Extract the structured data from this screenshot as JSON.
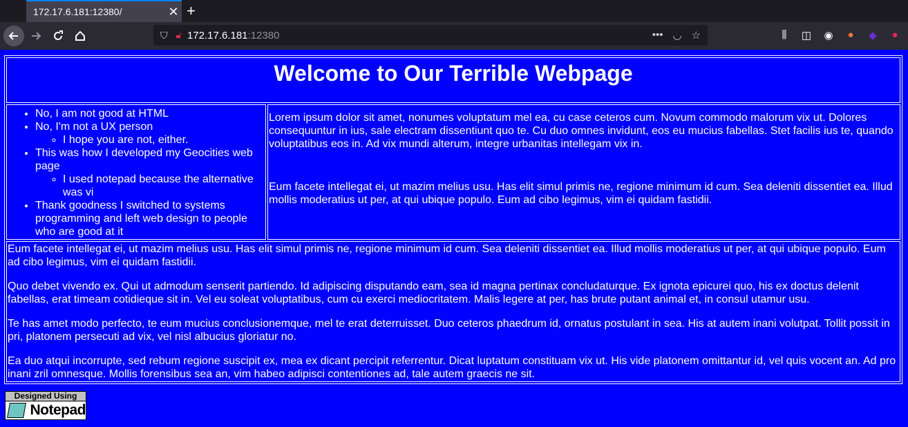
{
  "browser": {
    "tab_title": "172.17.6.181:12380/",
    "tab_close": "✕",
    "new_tab": "+",
    "url_host": "172.17.6.181",
    "url_port": ":12380",
    "icons": [
      "back-icon",
      "forward-icon",
      "reload-icon",
      "home-icon",
      "shield-icon",
      "insecure-lock-icon",
      "more-icon",
      "pocket-icon",
      "star-icon",
      "library-icon",
      "sidebar-icon",
      "account-icon",
      "extension-fox-icon",
      "extension-purple-icon",
      "extension-red-icon"
    ]
  },
  "page": {
    "title": "Welcome to Our Terrible Webpage",
    "list": {
      "item1": "No, I am not good at HTML",
      "item2": "No, I'm not a UX person",
      "item2_sub": "I hope you are not, either.",
      "item3": "This was how I developed my Geocities web page",
      "item3_sub": "I used notepad because the alternative was vi",
      "item4": "Thank goodness I switched to systems programming and left web design to people who are good at it"
    },
    "right_p1": "Lorem ipsum dolor sit amet, nonumes voluptatum mel ea, cu case ceteros cum. Novum commodo malorum vix ut. Dolores consequuntur in ius, sale electram dissentiunt quo te. Cu duo omnes invidunt, eos eu mucius fabellas. Stet facilis ius te, quando voluptatibus eos in. Ad vix mundi alterum, integre urbanitas intellegam vix in.",
    "right_p2": "Eum facete intellegat ei, ut mazim melius usu. Has elit simul primis ne, regione minimum id cum. Sea deleniti dissentiet ea. Illud mollis moderatius ut per, at qui ubique populo. Eum ad cibo legimus, vim ei quidam fastidii.",
    "bottom": [
      "Eum facete intellegat ei, ut mazim melius usu. Has elit simul primis ne, regione minimum id cum. Sea deleniti dissentiet ea. Illud mollis moderatius ut per, at qui ubique populo. Eum ad cibo legimus, vim ei quidam fastidii.",
      "Quo debet vivendo ex. Qui ut admodum senserit partiendo. Id adipiscing disputando eam, sea id magna pertinax concludaturque. Ex ignota epicurei quo, his ex doctus delenit fabellas, erat timeam cotidieque sit in. Vel eu soleat voluptatibus, cum cu exerci mediocritatem. Malis legere at per, has brute putant animal et, in consul utamur usu.",
      "Te has amet modo perfecto, te eum mucius conclusionemque, mel te erat deterruisset. Duo ceteros phaedrum id, ornatus postulant in sea. His at autem inani volutpat. Tollit possit in pri, platonem persecuti ad vix, vel nisl albucius gloriatur no.",
      "Ea duo atqui incorrupte, sed rebum regione suscipit ex, mea ex dicant percipit referrentur. Dicat luptatum constituam vix ut. His vide platonem omittantur id, vel quis vocent an. Ad pro inani zril omnesque. Mollis forensibus sea an, vim habeo adipisci contentiones ad, tale autem graecis ne sit."
    ],
    "badge_top": "Designed Using",
    "badge_name": "Notepad"
  },
  "colors": {
    "page_bg": "#0000ff",
    "text": "#ffffff"
  }
}
